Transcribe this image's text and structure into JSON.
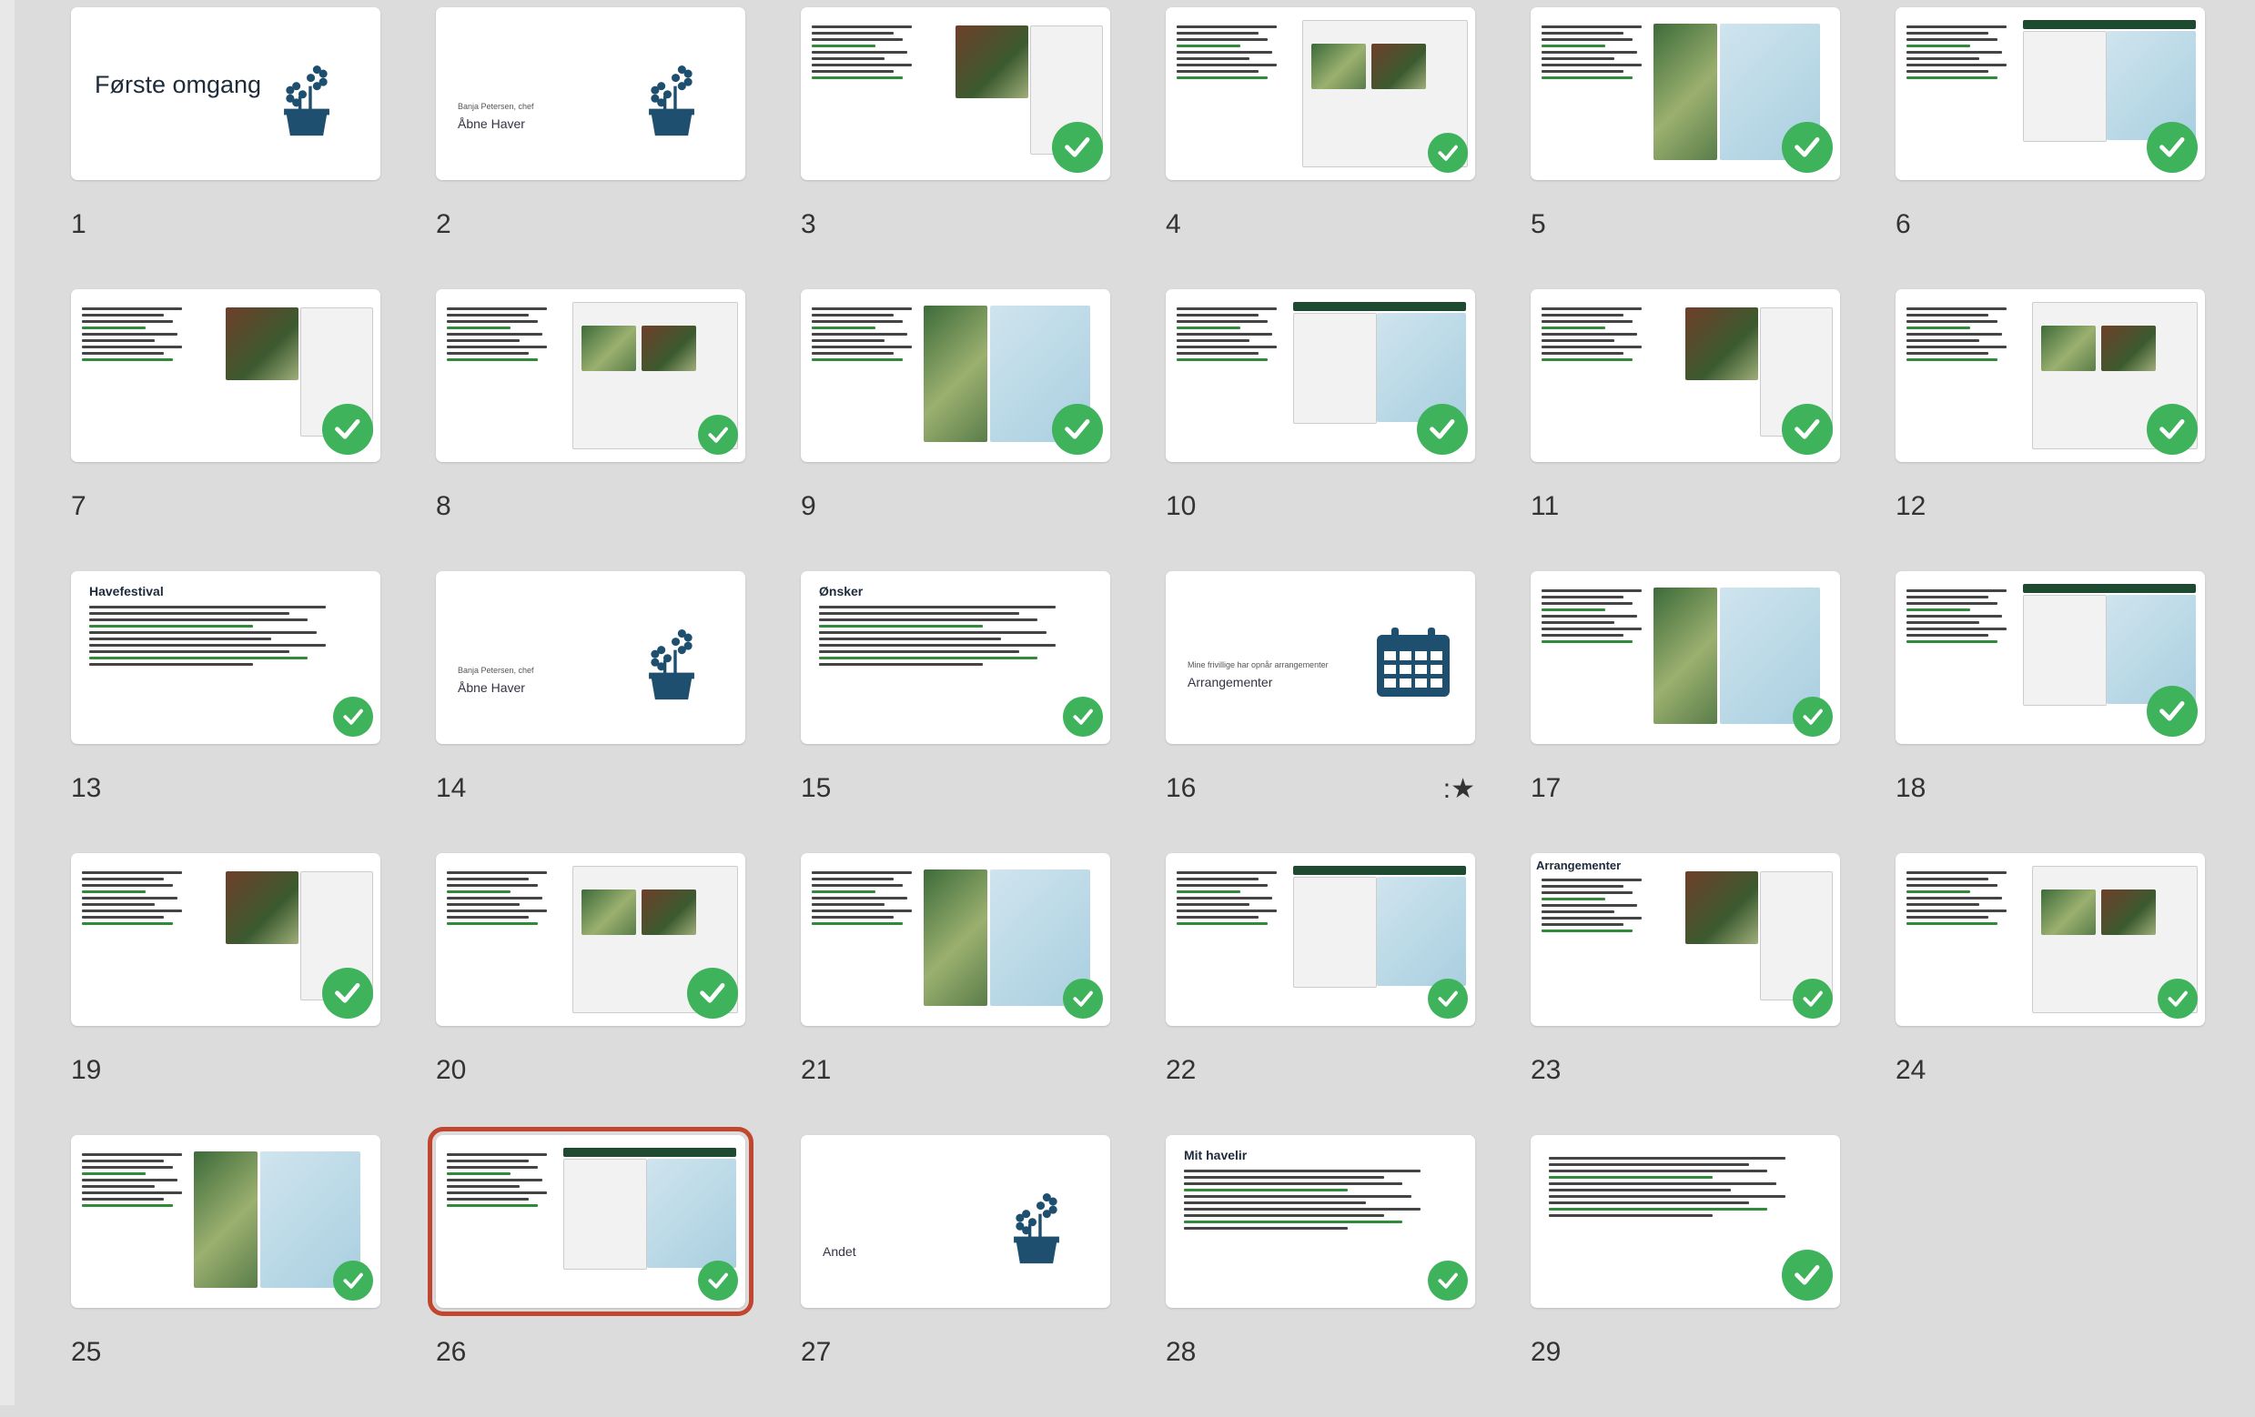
{
  "slides": [
    {
      "n": "1",
      "kind": "title",
      "title": "Første omgang",
      "check": false
    },
    {
      "n": "2",
      "kind": "section",
      "kicker": "Banja Petersen, chef",
      "subtitle": "Åbne Haver",
      "check": false
    },
    {
      "n": "3",
      "kind": "content",
      "check": true
    },
    {
      "n": "4",
      "kind": "content",
      "check": true,
      "small": true
    },
    {
      "n": "5",
      "kind": "content",
      "check": true
    },
    {
      "n": "6",
      "kind": "content",
      "check": true
    },
    {
      "n": "7",
      "kind": "content",
      "check": true
    },
    {
      "n": "8",
      "kind": "content",
      "check": true,
      "small": true
    },
    {
      "n": "9",
      "kind": "content",
      "check": true
    },
    {
      "n": "10",
      "kind": "content",
      "check": true
    },
    {
      "n": "11",
      "kind": "content",
      "check": true
    },
    {
      "n": "12",
      "kind": "content",
      "check": true
    },
    {
      "n": "13",
      "kind": "text",
      "title": "Havefestival",
      "check": true,
      "small": true
    },
    {
      "n": "14",
      "kind": "section",
      "kicker": "Banja Petersen, chef",
      "subtitle": "Åbne Haver",
      "check": false
    },
    {
      "n": "15",
      "kind": "text",
      "title": "Ønsker",
      "check": true,
      "small": true
    },
    {
      "n": "16",
      "kind": "calendar",
      "kicker": "Mine frivillige har opnår arrangementer",
      "subtitle": "Arrangementer",
      "check": false,
      "star": true
    },
    {
      "n": "17",
      "kind": "content",
      "check": true,
      "small": true
    },
    {
      "n": "18",
      "kind": "content",
      "check": true
    },
    {
      "n": "19",
      "kind": "content",
      "check": true
    },
    {
      "n": "20",
      "kind": "content",
      "check": true
    },
    {
      "n": "21",
      "kind": "content",
      "check": true,
      "small": true
    },
    {
      "n": "22",
      "kind": "content",
      "check": true,
      "small": true
    },
    {
      "n": "23",
      "kind": "content",
      "title": "Arrangementer",
      "check": true,
      "small": true
    },
    {
      "n": "24",
      "kind": "content",
      "check": true,
      "small": true
    },
    {
      "n": "25",
      "kind": "content",
      "check": true,
      "small": true
    },
    {
      "n": "26",
      "kind": "content",
      "check": true,
      "small": true,
      "selected": true
    },
    {
      "n": "27",
      "kind": "section",
      "subtitle": "Andet",
      "check": false
    },
    {
      "n": "28",
      "kind": "text",
      "title": "Mit havelir",
      "check": true,
      "small": true
    },
    {
      "n": "29",
      "kind": "text",
      "check": true
    }
  ],
  "colors": {
    "check": "#3fb25c",
    "selected": "#c0462f",
    "flower": "#1e4f6e"
  },
  "icons": {
    "check": "check-circle-icon",
    "flower": "flower-pot-icon",
    "calendar": "calendar-icon",
    "star": "star-icon"
  }
}
